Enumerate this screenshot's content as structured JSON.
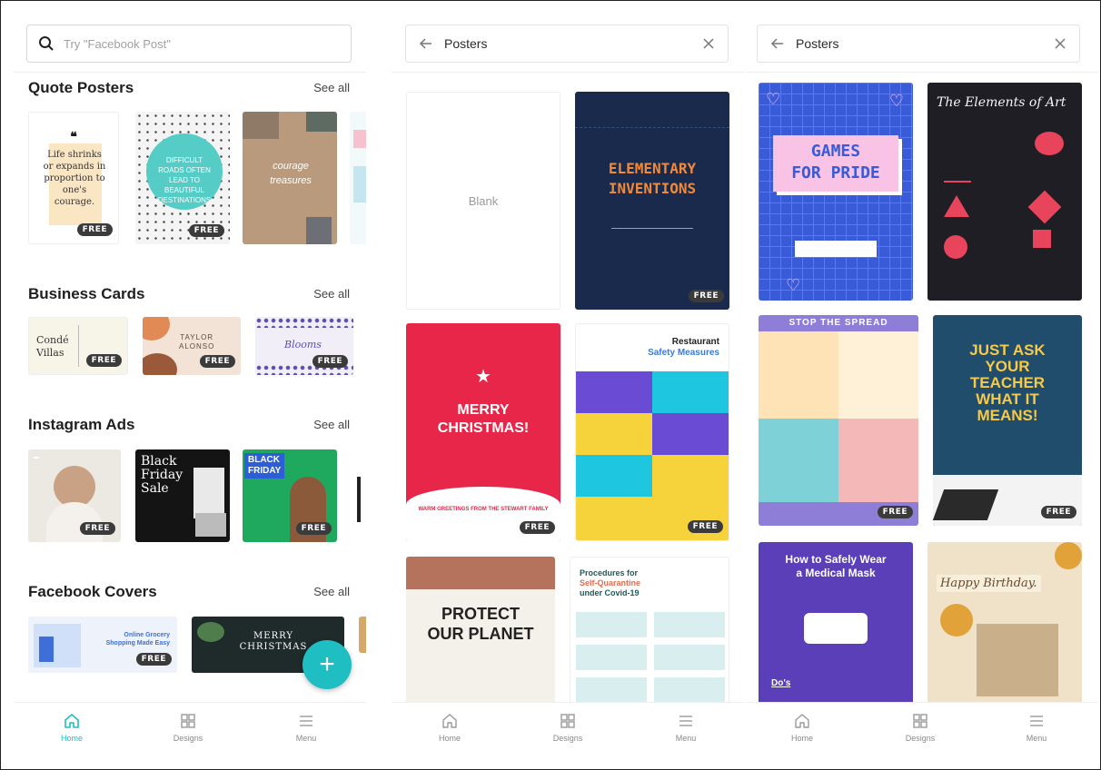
{
  "panel1": {
    "search": {
      "placeholder": "Try \"Facebook Post\""
    },
    "sections": [
      {
        "title": "Quote Posters",
        "see_all": "See all"
      },
      {
        "title": "Business Cards",
        "see_all": "See all"
      },
      {
        "title": "Instagram Ads",
        "see_all": "See all"
      },
      {
        "title": "Facebook Covers",
        "see_all": "See all"
      }
    ],
    "quote1_text": "Life shrinks or expands in proportion to one's courage.",
    "quote2_text": "DIFFICULT ROADS OFTEN LEAD TO BEAUTIFUL DESTINATIONS",
    "quote3_lines": [
      "courage",
      "treasures"
    ],
    "biz1": [
      "Condé",
      "Villas"
    ],
    "biz2": [
      "TAYLOR",
      "ALONSO"
    ],
    "biz3": "Blooms",
    "insta2": [
      "Black",
      "Friday",
      "Sale"
    ],
    "insta3": [
      "BLACK",
      "FRIDAY"
    ],
    "fb1": [
      "Online Grocery",
      "Shopping Made Easy"
    ],
    "fb2": [
      "MERRY",
      "CHRISTMAS"
    ],
    "fab": "+"
  },
  "panel2": {
    "header": {
      "title": "Posters"
    },
    "blank_label": "Blank",
    "elementary": {
      "line1": "ELEMENTARY",
      "line2": "INVENTIONS"
    },
    "christmas": {
      "line1": "MERRY",
      "line2": "CHRISTMAS!",
      "footer": "WARM GREETINGS FROM THE STEWART FAMILY"
    },
    "restaurant": {
      "line1": "Restaurant",
      "line2": "Safety Measures"
    },
    "planet": {
      "line1": "PROTECT",
      "line2": "OUR PLANET"
    },
    "quarantine": {
      "line1": "Procedures for",
      "line2": "Self-Quarantine",
      "line3": "under Covid-19"
    }
  },
  "panel3": {
    "header": {
      "title": "Posters"
    },
    "games": {
      "line1": "GAMES",
      "line2": "FOR PRIDE"
    },
    "art": {
      "title": "The Elements of Art"
    },
    "spread": {
      "title": "STOP THE SPREAD"
    },
    "teacher": {
      "lines": [
        "JUST ASK",
        "YOUR",
        "TEACHER",
        "WHAT IT",
        "MEANS!"
      ]
    },
    "mask": {
      "line1": "How to Safely Wear",
      "line2": "a Medical Mask",
      "dos": "Do's"
    },
    "birthday": {
      "text": "Happy Birthday."
    }
  },
  "badge_label": "FREE",
  "bottom_nav": [
    {
      "label": "Home",
      "icon": "home-icon"
    },
    {
      "label": "Designs",
      "icon": "grid-icon"
    },
    {
      "label": "Menu",
      "icon": "hamburger-icon"
    }
  ],
  "colors": {
    "accent": "#1ebec3",
    "badge": "#3b3b3b"
  }
}
